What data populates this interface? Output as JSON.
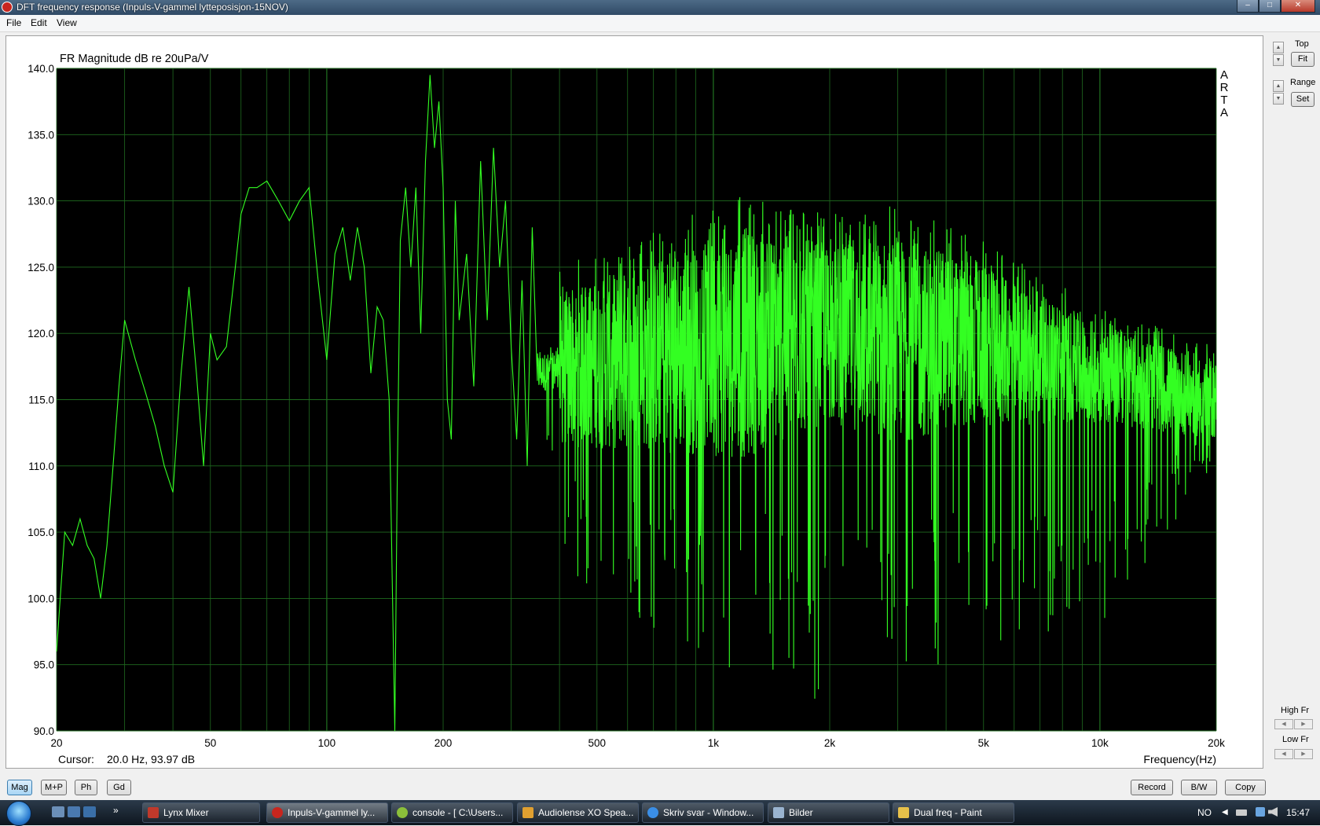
{
  "window": {
    "title": "DFT frequency response (Inpuls-V-gammel lytteposisjon-15NOV)",
    "buttons": [
      "–",
      "□",
      "✕"
    ]
  },
  "menu": [
    "File",
    "Edit",
    "View"
  ],
  "chart_data": {
    "type": "line",
    "title": "FR Magnitude dB re 20uPa/V",
    "watermark": "ARTA",
    "xlabel": "Frequency(Hz)",
    "ylabel": "",
    "xscale": "log",
    "xlim": [
      20,
      20000
    ],
    "ylim": [
      90,
      140
    ],
    "x_ticks": [
      {
        "value": 20,
        "label": "20"
      },
      {
        "value": 50,
        "label": "50"
      },
      {
        "value": 100,
        "label": "100"
      },
      {
        "value": 200,
        "label": "200"
      },
      {
        "value": 500,
        "label": "500"
      },
      {
        "value": 1000,
        "label": "1k"
      },
      {
        "value": 2000,
        "label": "2k"
      },
      {
        "value": 5000,
        "label": "5k"
      },
      {
        "value": 10000,
        "label": "10k"
      },
      {
        "value": 20000,
        "label": "20k"
      }
    ],
    "y_ticks": [
      "140.0",
      "135.0",
      "130.0",
      "125.0",
      "120.0",
      "115.0",
      "110.0",
      "105.0",
      "100.0",
      "95.0",
      "90.0"
    ],
    "grid": true,
    "background": "#000000",
    "line_color": "#33ff22",
    "grid_color": "#1f6b1f",
    "series": [
      {
        "x": [
          20,
          21,
          22,
          23,
          24,
          25,
          26,
          27,
          28,
          29,
          30,
          32,
          34,
          36,
          38,
          40,
          42,
          44,
          46,
          48,
          50,
          52,
          55,
          58,
          60,
          63,
          66,
          70,
          75,
          80,
          85,
          90,
          95,
          100,
          105,
          110,
          115,
          120,
          125,
          130,
          135,
          140,
          145,
          150,
          152,
          155,
          160,
          165,
          170,
          175,
          180,
          185,
          190,
          195,
          200,
          205,
          210,
          215,
          220,
          230,
          240,
          250,
          260,
          270,
          280,
          290,
          300,
          310,
          320,
          330,
          340,
          350
        ],
        "y": [
          96,
          105,
          104,
          106,
          104,
          103,
          100,
          104,
          110,
          116,
          121,
          118,
          115.5,
          113,
          110,
          108,
          117,
          123.5,
          117,
          110,
          120,
          118,
          119,
          125,
          129,
          131,
          131,
          131.5,
          130,
          128.5,
          130,
          131,
          124,
          118,
          126,
          128,
          124,
          128,
          125,
          117,
          122,
          121,
          115,
          90,
          108,
          127,
          131,
          125,
          131,
          120,
          133,
          139.5,
          134,
          137.5,
          131,
          115,
          112,
          130,
          121,
          126,
          116,
          133,
          121,
          134,
          125,
          130,
          119,
          112,
          124,
          110,
          128,
          117
        ]
      }
    ],
    "dense_region": {
      "from_hz": 350,
      "to_hz": 20000,
      "center_db": [
        [
          350,
          117
        ],
        [
          1000,
          119
        ],
        [
          2000,
          120
        ],
        [
          5000,
          119
        ],
        [
          10000,
          117
        ],
        [
          20000,
          115
        ]
      ],
      "peak_db": [
        [
          400,
          125
        ],
        [
          1200,
          131
        ],
        [
          2000,
          129
        ],
        [
          3000,
          130
        ],
        [
          5000,
          127
        ],
        [
          10000,
          122
        ],
        [
          20000,
          119
        ]
      ],
      "dip_db": [
        [
          400,
          101
        ],
        [
          1000,
          95
        ],
        [
          2000,
          92
        ],
        [
          5000,
          96
        ],
        [
          10000,
          98
        ],
        [
          20000,
          110
        ]
      ]
    }
  },
  "cursor": {
    "label": "Cursor:",
    "value": "20.0 Hz, 93.97 dB"
  },
  "side_panel": {
    "top_label": "Top",
    "fit_label": "Fit",
    "range_label": "Range",
    "set_label": "Set",
    "high_fr_label": "High Fr",
    "low_fr_label": "Low Fr"
  },
  "bottom_buttons": {
    "mag": "Mag",
    "mp": "M+P",
    "ph": "Ph",
    "gd": "Gd",
    "record": "Record",
    "bw": "B/W",
    "copy": "Copy"
  },
  "taskbar": {
    "tasks": [
      "Lynx Mixer",
      "Inpuls-V-gammel ly...",
      "console - [ C:\\Users...",
      "Audiolense XO Spea...",
      "Skriv svar - Window...",
      "Bilder",
      "Dual freq - Paint"
    ],
    "quicklaunch_more": "»",
    "lang": "NO",
    "time": "15:47"
  }
}
